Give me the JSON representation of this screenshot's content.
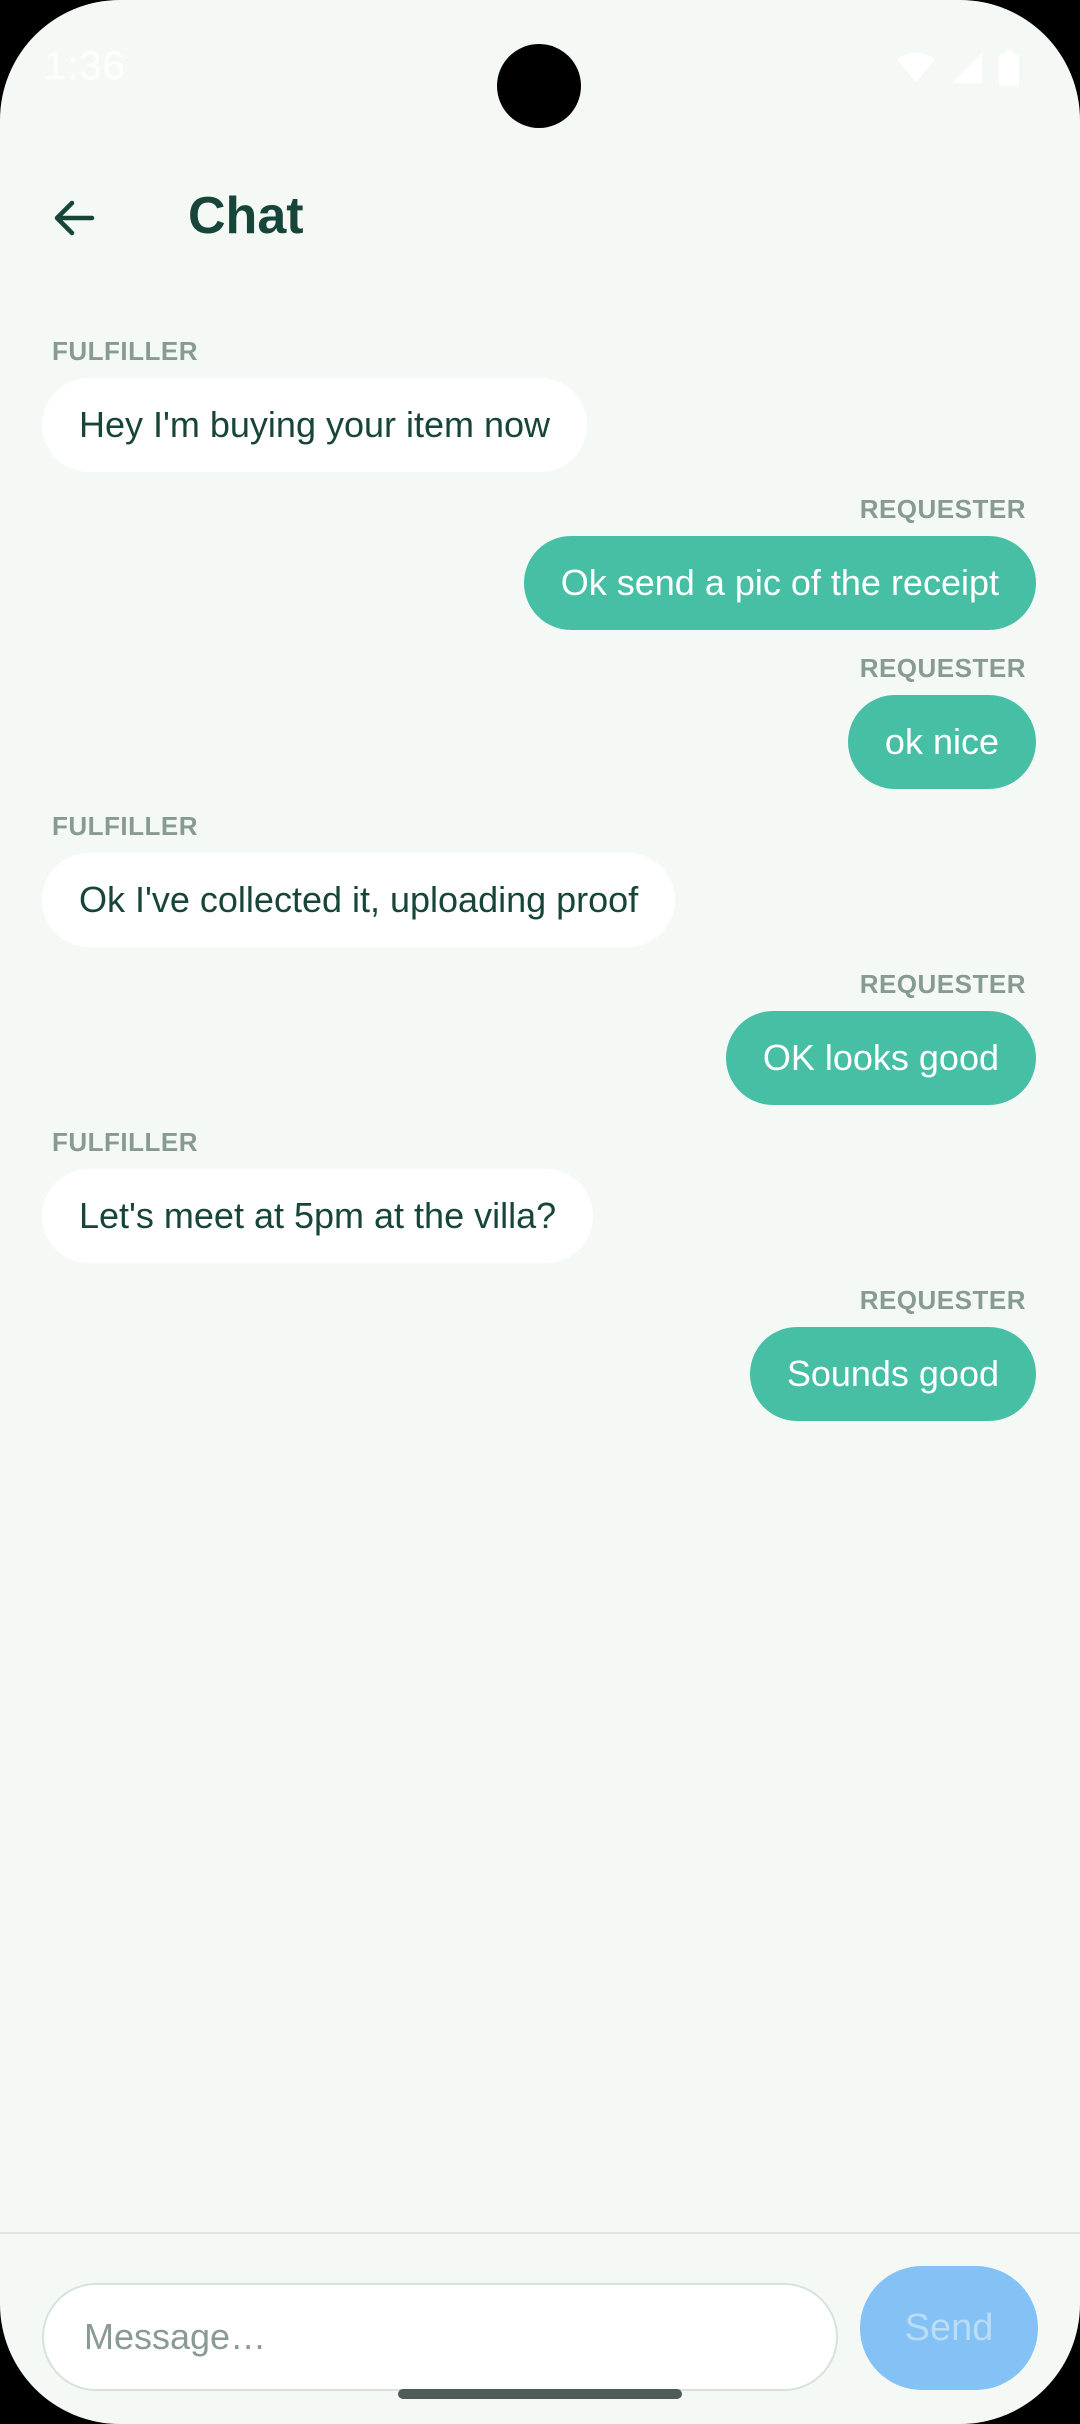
{
  "status_bar": {
    "time": "1:36",
    "icons": [
      "wifi-icon",
      "signal-icon",
      "battery-icon"
    ]
  },
  "header": {
    "back_icon": "arrow-left-icon",
    "title": "Chat"
  },
  "messages": [
    {
      "sender": "FULFILLER",
      "side": "left",
      "text": "Hey I'm buying your item now"
    },
    {
      "sender": "REQUESTER",
      "side": "right",
      "text": "Ok send a pic of the receipt"
    },
    {
      "sender": "REQUESTER",
      "side": "right",
      "text": "ok nice"
    },
    {
      "sender": "FULFILLER",
      "side": "left",
      "text": "Ok I've collected it, uploading proof"
    },
    {
      "sender": "REQUESTER",
      "side": "right",
      "text": "OK looks good"
    },
    {
      "sender": "FULFILLER",
      "side": "left",
      "text": "Let's meet at 5pm at the villa?"
    },
    {
      "sender": "REQUESTER",
      "side": "right",
      "text": "Sounds good"
    }
  ],
  "composer": {
    "placeholder": "Message…",
    "value": "",
    "send_label": "Send"
  },
  "colors": {
    "background": "#f4f9f6",
    "accent": "#47bfa5",
    "title": "#17453a",
    "send_disabled": "#84c1f4"
  }
}
